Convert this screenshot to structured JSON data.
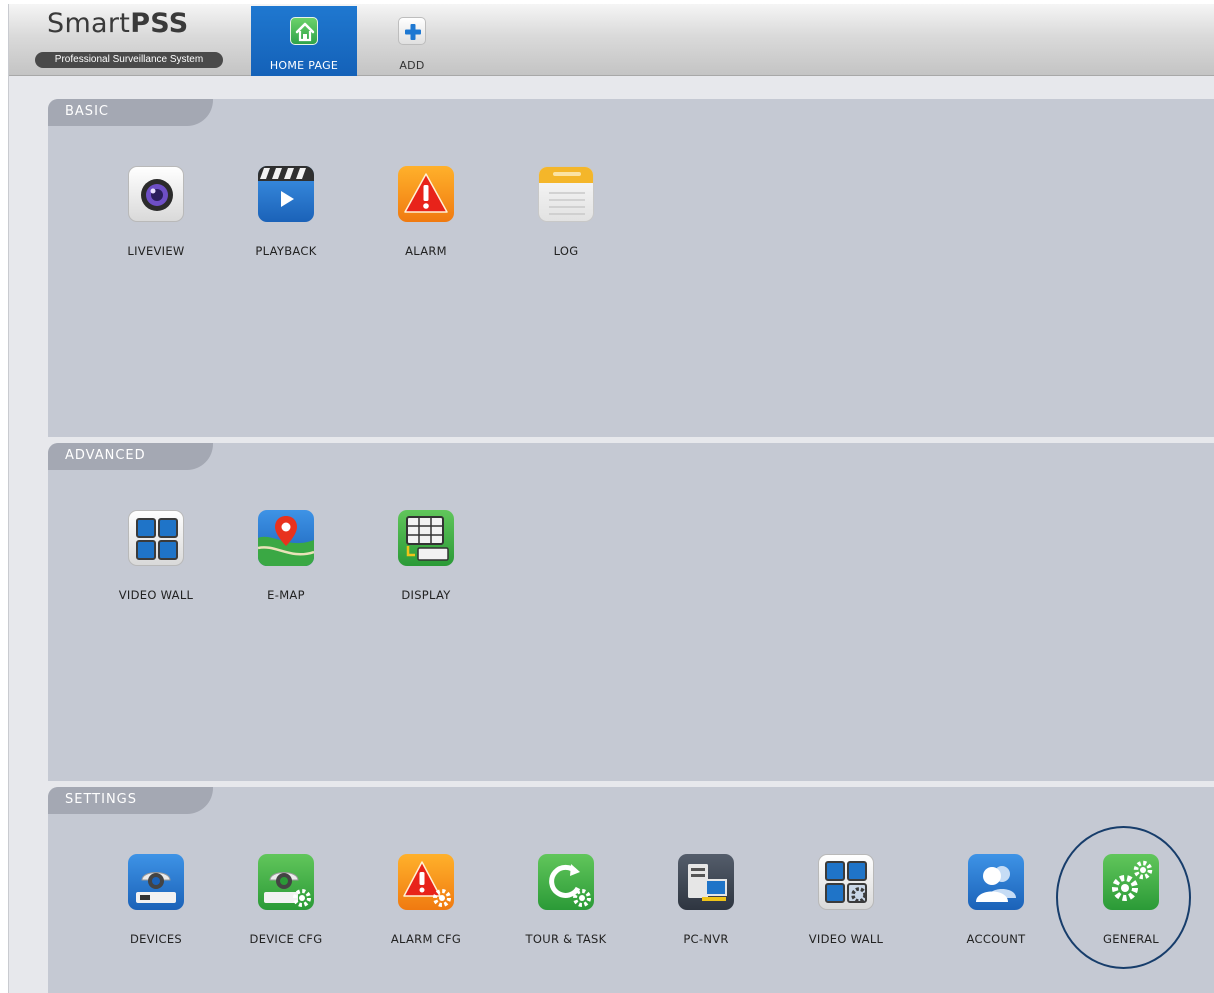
{
  "app": {
    "logo": {
      "name_light": "Smart",
      "name_bold": "PSS",
      "subtitle": "Professional Surveillance System"
    }
  },
  "topnav": {
    "tabs": [
      {
        "label": "HOME PAGE",
        "icon": "home-icon",
        "active": true
      },
      {
        "label": "ADD",
        "icon": "plus-icon",
        "active": false
      }
    ]
  },
  "sections": {
    "basic": {
      "title": "BASIC",
      "items": [
        {
          "label": "LIVEVIEW",
          "icon": "camera-lens-icon"
        },
        {
          "label": "PLAYBACK",
          "icon": "clapperboard-play-icon"
        },
        {
          "label": "ALARM",
          "icon": "warning-triangle-icon"
        },
        {
          "label": "LOG",
          "icon": "notepad-icon"
        }
      ]
    },
    "advanced": {
      "title": "ADVANCED",
      "items": [
        {
          "label": "VIDEO WALL",
          "icon": "video-wall-grid-icon"
        },
        {
          "label": "E-MAP",
          "icon": "map-pin-icon"
        },
        {
          "label": "DISPLAY",
          "icon": "display-grid-icon"
        }
      ]
    },
    "settings": {
      "title": "SETTINGS",
      "items": [
        {
          "label": "DEVICES",
          "icon": "dome-camera-icon"
        },
        {
          "label": "DEVICE CFG",
          "icon": "dome-camera-gear-icon"
        },
        {
          "label": "ALARM CFG",
          "icon": "warning-gear-icon"
        },
        {
          "label": "TOUR & TASK",
          "icon": "refresh-gear-icon"
        },
        {
          "label": "PC-NVR",
          "icon": "server-monitor-icon"
        },
        {
          "label": "VIDEO WALL",
          "icon": "video-wall-gear-icon"
        },
        {
          "label": "ACCOUNT",
          "icon": "users-icon"
        },
        {
          "label": "GENERAL",
          "icon": "gears-icon"
        }
      ]
    }
  },
  "colors": {
    "active_tab": "#1461b8",
    "section_bg": "#c5c9d3",
    "section_tab": "#a4a8b3",
    "highlight_ring": "#173d6b"
  }
}
